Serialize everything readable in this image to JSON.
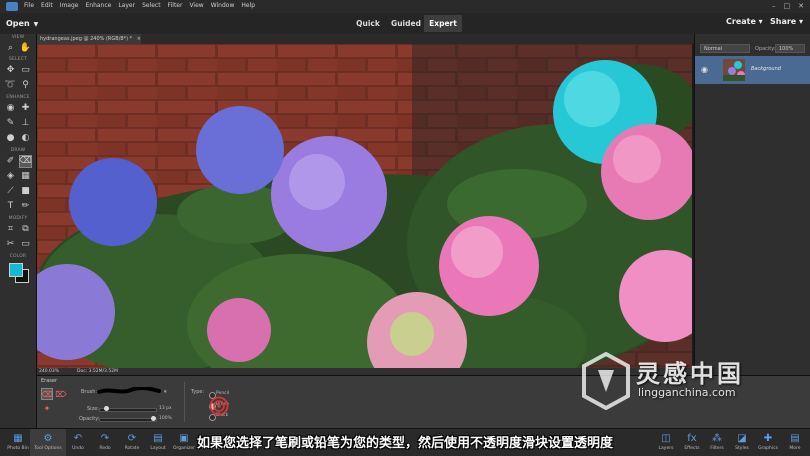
{
  "menubar": {
    "items": [
      "File",
      "Edit",
      "Image",
      "Enhance",
      "Layer",
      "Select",
      "Filter",
      "View",
      "Window",
      "Help"
    ],
    "window_controls": [
      "–",
      "□",
      "✕"
    ]
  },
  "modebar": {
    "open_label": "Open",
    "tabs": [
      {
        "label": "Quick",
        "active": false
      },
      {
        "label": "Guided",
        "active": false
      },
      {
        "label": "Expert",
        "active": true
      }
    ],
    "create_label": "Create",
    "share_label": "Share"
  },
  "toolbox": {
    "sections": [
      "VIEW",
      "SELECT",
      "ENHANCE",
      "DRAW",
      "MODIFY",
      "COLOR"
    ],
    "foreground_color": "#16b9d2",
    "background_color": "#111111"
  },
  "document": {
    "tab_title": "hydrangeas.jpeg @ 240% (RGB/8*) *",
    "zoom_readout": "240.03%",
    "doc_size": "Doc: 3.52M/3.52M"
  },
  "layers_panel": {
    "blend_mode": "Normal",
    "opacity_label": "Opacity:",
    "opacity_value": "100%",
    "layer_name": "Background"
  },
  "tool_options": {
    "tool_name": "Eraser",
    "brush_label": "Brush:",
    "size_label": "Size:",
    "size_value": "13 px",
    "size_fraction": 0.12,
    "opacity_label": "Opacity:",
    "opacity_value": "100%",
    "opacity_fraction": 1.0,
    "type_label": "Type:",
    "type_options": [
      "Pencil",
      "Brush",
      "Block"
    ],
    "type_selected": "Brush"
  },
  "bottombar": {
    "left_items": [
      {
        "label": "Photo Bin",
        "icon": "photo-bin-icon"
      },
      {
        "label": "Tool Options",
        "icon": "tool-options-icon"
      },
      {
        "label": "Undo",
        "icon": "undo-icon"
      },
      {
        "label": "Redo",
        "icon": "redo-icon"
      },
      {
        "label": "Rotate",
        "icon": "rotate-icon"
      },
      {
        "label": "Layout",
        "icon": "layout-icon"
      },
      {
        "label": "Organizer",
        "icon": "organizer-icon"
      },
      {
        "label": "Home Screen",
        "icon": "home-icon"
      }
    ],
    "right_items": [
      {
        "label": "Layers",
        "icon": "layers-icon"
      },
      {
        "label": "Effects",
        "icon": "effects-icon"
      },
      {
        "label": "Filters",
        "icon": "filters-icon"
      },
      {
        "label": "Styles",
        "icon": "styles-icon"
      },
      {
        "label": "Graphics",
        "icon": "graphics-icon"
      },
      {
        "label": "More",
        "icon": "more-icon"
      }
    ]
  },
  "subtitle": "如果您选择了笔刷或铅笔为您的类型，然后使用不透明度滑块设置透明度",
  "watermark": {
    "cn": "灵感中国",
    "url": "lingganchina.com"
  }
}
